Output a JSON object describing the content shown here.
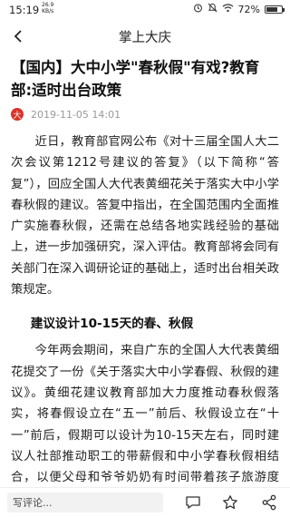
{
  "status_bar": {
    "time": "15:19",
    "net_speed": "26.9",
    "net_unit": "KB/s",
    "battery_text": "72%",
    "battery_level": 0.72
  },
  "navbar": {
    "title": "掌上大庆"
  },
  "article": {
    "title": "【国内】大中小学\"春秋假\"有戏?教育部:适时出台政策",
    "source_logo": "大",
    "date": "2019-11-05 14:01",
    "paragraphs": [
      "近日，教育部官网公布《对十三届全国人大二次会议第1212号建议的答复》（以下简称“答复”），回应全国人大代表黄细花关于落实大中小学春秋假的建议。答复中指出，在全国范围内全面推广实施春秋假，还需在总结各地实践经验的基础上，进一步加强研究，深入评估。教育部将会同有关部门在深入调研论证的基础上，适时出台相关政策规定。"
    ],
    "subheading": "建议设计10-15天的春、秋假",
    "paragraphs2": [
      "今年两会期间，来自广东的全国人大代表黄细花提交了一份《关于落实大中小学春假、秋假的建议》。黄细花建议教育部加大力度推动春秋假落实，将春假设立在“五一”前后、秋假设立在“十一”前后，假期可以设计为10-15天左右，同时建议人社部推动职工的带薪假和中小学春秋假相结合，以便父母和爷爷奶奶有时间带着孩子旅游度假。"
    ]
  },
  "bottom_bar": {
    "comment_placeholder": "写评论..."
  }
}
